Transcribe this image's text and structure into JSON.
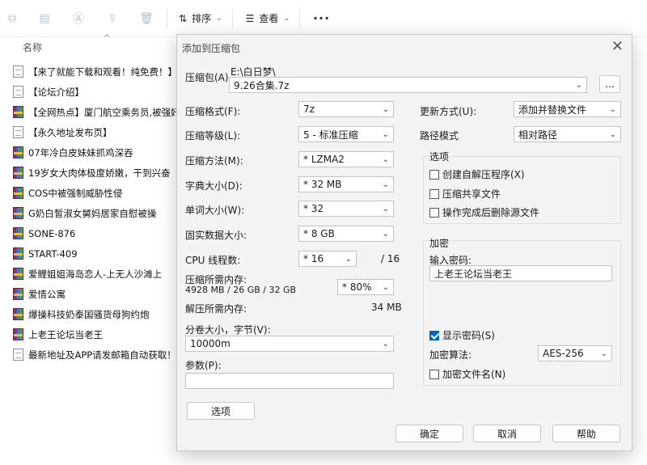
{
  "toolbar": {
    "sort_label": "排序",
    "view_label": "查看",
    "more_label": "···"
  },
  "columns": {
    "name": "名称"
  },
  "files": [
    {
      "type": "doc",
      "name": "【来了就能下载和观看！纯免费！】"
    },
    {
      "type": "doc",
      "name": "【论坛介绍】"
    },
    {
      "type": "rar",
      "name": "【全网热点】厦门航空乘务员,被强奸"
    },
    {
      "type": "doc",
      "name": "【永久地址发布页】"
    },
    {
      "type": "rar",
      "name": "07年冷白皮妹妹抓鸡深吞"
    },
    {
      "type": "rar",
      "name": "19岁女大肉体极度娇嫩，干到兴奋"
    },
    {
      "type": "rar",
      "name": "COS中被强制威胁性侵"
    },
    {
      "type": "rar",
      "name": "G奶白皙淑女舅妈居家自慰被操"
    },
    {
      "type": "rar",
      "name": "SONE-876"
    },
    {
      "type": "rar",
      "name": "START-409"
    },
    {
      "type": "rar",
      "name": "爱鲤姐姐海岛恋人-上无人沙滩上"
    },
    {
      "type": "rar",
      "name": "爱情公寓"
    },
    {
      "type": "rar",
      "name": "爆操科技奶泰国骚货母狗约炮"
    },
    {
      "type": "rar",
      "name": "上老王论坛当老王"
    },
    {
      "type": "doc",
      "name": "最新地址及APP请发邮箱自动获取！！"
    }
  ],
  "dialog": {
    "title": "添加到压缩包",
    "archive_label": "压缩包(A)",
    "archive_path": "E:\\白日梦\\",
    "archive_name": "9.26合集.7z",
    "browse_label": "...",
    "format_label": "压缩格式(F):",
    "format_value": "7z",
    "level_label": "压缩等级(L):",
    "level_value": "5 - 标准压缩",
    "method_label": "压缩方法(M):",
    "method_value": "* LZMA2",
    "dict_label": "字典大小(D):",
    "dict_value": "* 32 MB",
    "word_label": "单词大小(W):",
    "word_value": "* 32",
    "solid_label": "固实数据大小:",
    "solid_value": "* 8 GB",
    "cpu_label": "CPU 线程数:",
    "cpu_value": "* 16",
    "cpu_total": "/ 16",
    "mem_comp_label": "压缩所需内存:",
    "mem_comp_detail": "4928 MB / 26 GB / 32 GB",
    "mem_comp_value": "* 80%",
    "mem_decomp_label": "解压所需内存:",
    "mem_decomp_value": "34 MB",
    "split_label": "分卷大小，字节(V):",
    "split_value": "10000m",
    "params_label": "参数(P):",
    "params_value": "",
    "options_button": "选项",
    "update_label": "更新方式(U):",
    "update_value": "添加并替换文件",
    "path_label": "路径模式",
    "path_value": "相对路径",
    "options_group": "选项",
    "opt_sfx": "创建自解压程序(X)",
    "opt_shared": "压缩共享文件",
    "opt_delete": "操作完成后删除源文件",
    "encrypt_group": "加密",
    "password_label": "输入密码:",
    "password_value": "上老王论坛当老王",
    "show_password": "显示密码(S)",
    "enc_method_label": "加密算法:",
    "enc_method_value": "AES-256",
    "enc_names": "加密文件名(N)",
    "ok": "确定",
    "cancel": "取消",
    "help": "帮助"
  }
}
